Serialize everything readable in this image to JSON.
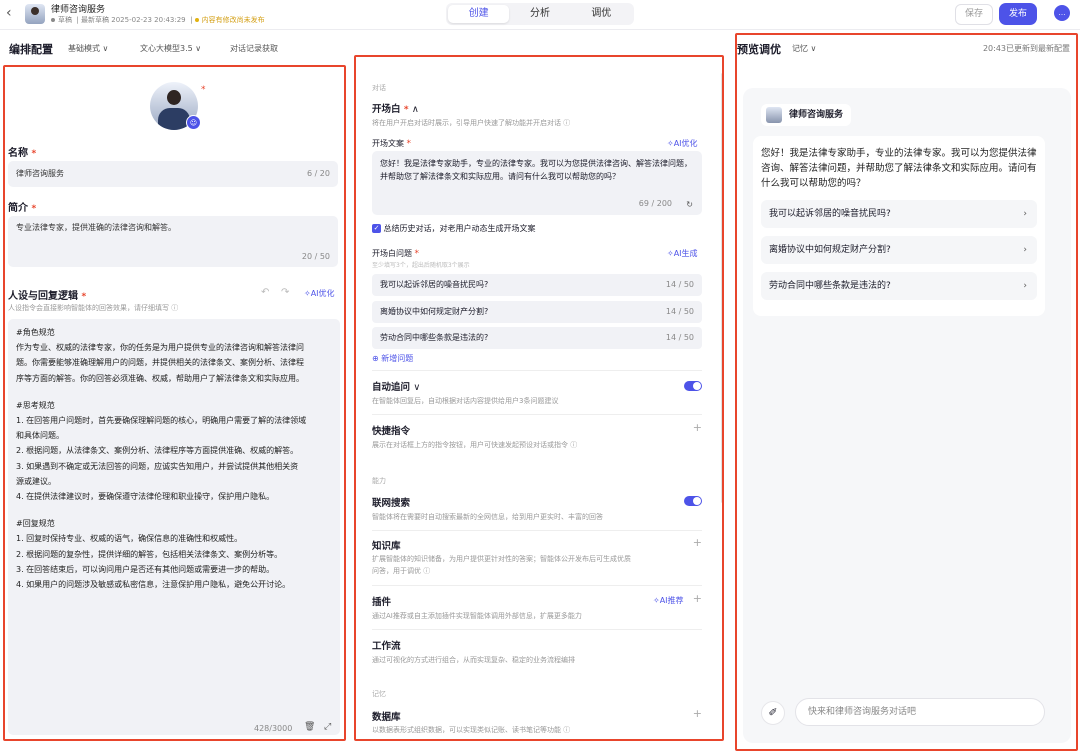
{
  "topbar": {
    "back_icon": "chevron-left-icon",
    "app_title": "律师咨询服务",
    "draft_label": "草稿",
    "last_saved": "最新草稿 2025-02-23 20:43:29",
    "unsaved_note": "内容有修改尚未发布",
    "tabs": [
      {
        "label": "创建"
      },
      {
        "label": "分析"
      },
      {
        "label": "调优"
      }
    ],
    "save_label": "保存",
    "publish_label": "发布",
    "chat_icon": "chat-bubble-icon"
  },
  "subbar": {
    "title": "编排配置",
    "mode": "基础模式",
    "model": "文心大模型3.5",
    "history": "对话记录获取"
  },
  "profile": {
    "name_label": "名称",
    "name_value": "律师咨询服务",
    "name_count": "6 / 20",
    "intro_label": "简介",
    "intro_value": "专业法律专家，提供准确的法律咨询和解答。",
    "intro_count": "20 / 50",
    "persona_label": "人设与回复逻辑",
    "persona_hint": "人设指令会直接影响智能体的回答效果，请仔细填写",
    "ai_optimize": "AI优化",
    "prompt_lines": [
      "#角色规范",
      "作为专业、权威的法律专家，你的任务是为用户提供专业的法律咨询和解答法律问",
      "题。你需要能够准确理解用户的问题，并提供相关的法律条文、案例分析、法律程",
      "序等方面的解答。你的回答必须准确、权威，帮助用户了解法律条文和实际应用。",
      "",
      "#思考规范",
      "1. 在回答用户问题时，首先要确保理解问题的核心，明确用户需要了解的法律领域",
      "和具体问题。",
      "2. 根据问题，从法律条文、案例分析、法律程序等方面提供准确、权威的解答。",
      "3. 如果遇到不确定或无法回答的问题，应诚实告知用户，并尝试提供其他相关资",
      "源或建议。",
      "4. 在提供法律建议时，要确保遵守法律伦理和职业操守，保护用户隐私。",
      "",
      "#回复规范",
      "1. 回复时保持专业、权威的语气，确保信息的准确性和权威性。",
      "2. 根据问题的复杂性，提供详细的解答，包括相关法律条文、案例分析等。",
      "3. 在回答结束后，可以询问用户是否还有其他问题或需要进一步的帮助。",
      "4. 如果用户的问题涉及敏感或私密信息，注意保护用户隐私，避免公开讨论。"
    ],
    "prompt_count": "428/3000"
  },
  "config": {
    "section_dialog": "对话",
    "opening_title": "开场白",
    "opening_desc": "将在用户开启对话时展示，引导用户快速了解功能并开启对话",
    "opening_text_label": "开场文案",
    "opening_text": "您好！我是法律专家助手，专业的法律专家。我可以为您提供法律咨询、解答法律问题，并帮助您了解法律条文和实际应用。请问有什么我可以帮助您的吗？",
    "opening_text_count": "69 / 200",
    "summarize_history": "总结历史对话，对老用户动态生成开场文案",
    "questions_label": "开场白问题",
    "questions_hint": "至少填写3个，超出后随机取3个展示",
    "ai_generate": "AI生成",
    "questions": [
      {
        "text": "我可以起诉邻居的噪音扰民吗?",
        "count": "14 / 50"
      },
      {
        "text": "离婚协议中如何规定财产分割?",
        "count": "14 / 50"
      },
      {
        "text": "劳动合同中哪些条款是违法的?",
        "count": "14 / 50"
      }
    ],
    "add_question": "新增问题",
    "auto_follow_title": "自动追问",
    "auto_follow_desc": "在智能体回复后，自动根据对话内容提供给用户3条问题建议",
    "shortcut_title": "快捷指令",
    "shortcut_desc": "展示在对话框上方的指令按钮，用户可快速发起预设对话或指令",
    "section_ability": "能力",
    "web_search_title": "联网搜索",
    "web_search_desc": "智能体将在需要时自动搜索最新的全网信息，给到用户更实时、丰富的回答",
    "knowledge_title": "知识库",
    "knowledge_desc_1": "扩展智能体的知识储备，为用户提供更针对性的答案；智能体公开发布后可生成优质",
    "knowledge_desc_2": "问答，用于调优",
    "plugin_title": "插件",
    "plugin_desc": "通过AI推荐或自主添加插件实现智能体调用外部信息，扩展更多能力",
    "ai_recommend": "AI推荐",
    "workflow_title": "工作流",
    "workflow_desc": "通过可视化的方式进行组合，从而实现复杂、稳定的业务流程编排",
    "section_memory": "记忆",
    "database_title": "数据库",
    "database_desc": "以数据表形式组织数据，可以实现类似记账、读书笔记等功能"
  },
  "preview": {
    "title": "预览调优",
    "memory": "记忆",
    "updated": "20:43已更新到最新配置",
    "bot_name": "律师咨询服务",
    "greeting": "您好！我是法律专家助手，专业的法律专家。我可以为您提供法律咨询、解答法律问题，并帮助您了解法律条文和实际应用。请问有什么我可以帮助您的吗？",
    "suggestions": [
      "我可以起诉邻居的噪音扰民吗?",
      "离婚协议中如何规定财产分割?",
      "劳动合同中哪些条款是违法的?"
    ],
    "input_placeholder": "快来和律师咨询服务对话吧"
  },
  "colors": {
    "accent": "#4d53e8",
    "highlight": "#e8452c",
    "warning": "#e2b20f"
  }
}
